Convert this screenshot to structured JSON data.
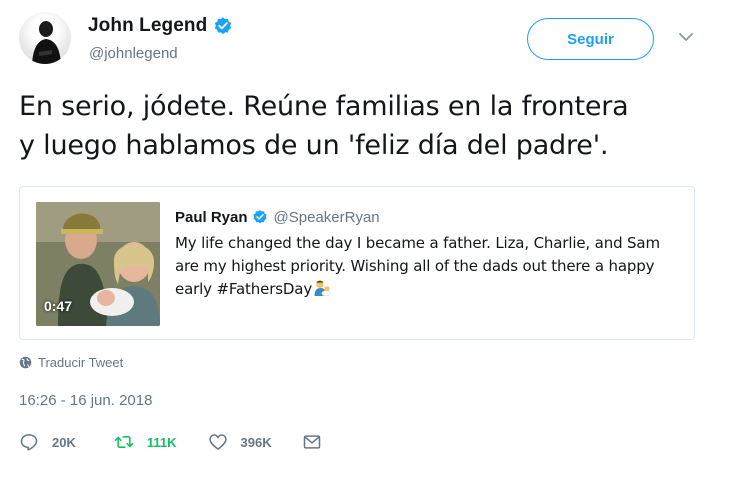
{
  "colors": {
    "accent": "#1da1f2",
    "retweet": "#17bf63",
    "muted": "#657786",
    "text": "#14171a"
  },
  "author": {
    "display_name": "John Legend",
    "handle": "@johnlegend",
    "verified_icon": "verified-badge-icon",
    "avatar_icon": "avatar"
  },
  "follow_button": {
    "label": "Seguir"
  },
  "tweet": {
    "text_line1": "En serio, jódete. Reúne familias en la frontera",
    "text_line2": "y luego hablamos de un 'feliz día del padre'."
  },
  "quoted": {
    "display_name": "Paul Ryan",
    "handle": "@SpeakerRyan",
    "video_duration": "0:47",
    "text": "My life changed the day I became a father. Liza, Charlie, and Sam are my highest priority. Wishing all of the dads out there a happy early #FathersDay",
    "emoji": "man-with-baby-emoji"
  },
  "translate": {
    "label": "Traducir Tweet",
    "icon": "globe-icon"
  },
  "timestamp": "16:26 - 16 jun. 2018",
  "actions": {
    "reply": {
      "icon": "reply-icon",
      "count": "20K"
    },
    "retweet": {
      "icon": "retweet-icon",
      "count": "111K"
    },
    "like": {
      "icon": "heart-icon",
      "count": "396K"
    },
    "dm": {
      "icon": "envelope-icon"
    }
  }
}
